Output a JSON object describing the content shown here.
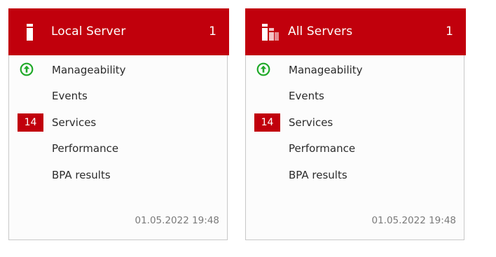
{
  "colors": {
    "accent": "#c1000c",
    "ok_green": "#1fa928",
    "text": "#2b2b2b",
    "muted_text": "#7a7a7a"
  },
  "tiles": [
    {
      "title": "Local Server",
      "count": "1",
      "icon": "single-server-icon",
      "rows": {
        "manageability": {
          "label": "Manageability",
          "status_icon": "up-arrow-circle-icon"
        },
        "events": {
          "label": "Events"
        },
        "services": {
          "label": "Services",
          "badge": "14"
        },
        "performance": {
          "label": "Performance"
        },
        "bpa": {
          "label": "BPA results"
        }
      },
      "timestamp": "01.05.2022 19:48"
    },
    {
      "title": "All Servers",
      "count": "1",
      "icon": "multiple-servers-icon",
      "rows": {
        "manageability": {
          "label": "Manageability",
          "status_icon": "up-arrow-circle-icon"
        },
        "events": {
          "label": "Events"
        },
        "services": {
          "label": "Services",
          "badge": "14"
        },
        "performance": {
          "label": "Performance"
        },
        "bpa": {
          "label": "BPA results"
        }
      },
      "timestamp": "01.05.2022 19:48"
    }
  ]
}
